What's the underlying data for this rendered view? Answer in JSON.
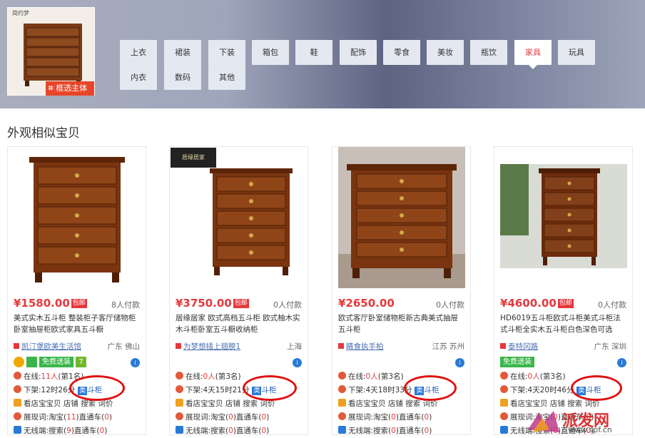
{
  "header": {
    "thumb_badge": "框选主体",
    "thumb_caption": "简约梦"
  },
  "categories": [
    {
      "label": "上衣"
    },
    {
      "label": "内衣"
    },
    {
      "label": "裙装"
    },
    {
      "label": "数码"
    },
    {
      "label": "下装"
    },
    {
      "label": "其他"
    },
    {
      "label": "箱包"
    },
    {
      "label": "鞋"
    },
    {
      "label": "配饰"
    },
    {
      "label": "零食"
    },
    {
      "label": "美妆"
    },
    {
      "label": "瓶饮"
    },
    {
      "label": "家具"
    },
    {
      "label": "玩具"
    }
  ],
  "section_title": "外观相似宝贝",
  "products": [
    {
      "price": "¥1580.00",
      "baoyou": "包邮",
      "paid": "8人付款",
      "title": "美式实木五斗柜 整装柜子客厅储物柜卧室抽屉柜欧式家具五斗橱",
      "shop": "凯汀堡欧美生活馆",
      "loc": "广东 佛山",
      "badge_free": "免费送装",
      "online": "在线:",
      "online_n": "11人",
      "online_rank": "(第1名)",
      "shelf": "下架:12时26分",
      "cat_icon": "类",
      "cat_name": "斗柜",
      "view": "看店宝宝贝 店铺 搜索 词价",
      "show": "展现词:淘宝(",
      "show_n": "11",
      "show_mid": ")直通车(",
      "show_n2": "0",
      "show_end": ")",
      "wireless": "无线端:搜索(",
      "wireless_n": "9",
      "wireless_mid": ")直通车(",
      "wireless_n2": "0",
      "wireless_end": ")"
    },
    {
      "price": "¥3750.00",
      "baoyou": "包邮",
      "paid": "0人付款",
      "title": "居缘居家 欧式高档五斗柜 欧式柚木实木斗柜卧室五斗橱收纳柜",
      "shop": "为梦想插上翅膀1",
      "loc": "上海",
      "img_tag": "居缘居家",
      "online": "在线:",
      "online_n": "0人",
      "online_rank": "(第3名)",
      "shelf": "下架:4天15时21分",
      "cat_icon": "类",
      "cat_name": "斗柜",
      "view": "看店宝宝贝 店铺 搜索 词价",
      "show": "展现词:淘宝(",
      "show_n": "0",
      "show_mid": ")直通车(",
      "show_n2": "0",
      "show_end": ")",
      "wireless": "无线端:搜索(",
      "wireless_n": "0",
      "wireless_mid": ")直通车(",
      "wireless_n2": "0",
      "wireless_end": ")"
    },
    {
      "price": "¥2650.00",
      "paid": "0人付款",
      "title": "欧式客厅卧室储物柜新古典美式抽屉五斗柜",
      "shop": "睛食执手柏",
      "loc": "江苏 苏州",
      "online": "在线:",
      "online_n": "0人",
      "online_rank": "(第3名)",
      "shelf": "下架:4天18时33分",
      "cat_icon": "类",
      "cat_name": "斗柜",
      "view": "看店宝宝贝 店铺 搜索 词价",
      "show": "展现词:淘宝(",
      "show_n": "0",
      "show_mid": ")直通车(",
      "show_n2": "0",
      "show_end": ")",
      "wireless": "无线端:搜索(",
      "wireless_n": "0",
      "wireless_mid": ")直通车(",
      "wireless_n2": "0",
      "wireless_end": ")"
    },
    {
      "price": "¥4600.00",
      "baoyou": "包邮",
      "paid": "0人付款",
      "title": "HD6019五斗柜欧式斗柜美式斗柜法式斗柜全实木五斗柜白色深色可选",
      "shop": "泰特冈路",
      "loc": "广东 深圳",
      "badge_free": "免费送装",
      "online": "在线:",
      "online_n": "0人",
      "online_rank": "(第3名)",
      "shelf": "下架:4天20时46分",
      "cat_icon": "类",
      "cat_name": "斗柜",
      "view": "看店宝宝贝 店铺 搜索 词价",
      "show": "展现词:淘宝(",
      "show_n": "0",
      "show_mid": ")直通车(",
      "show_n2": "0",
      "show_end": ")",
      "wireless": "无线端:搜索(",
      "wireless_n": "0",
      "wireless_mid": ")直通车(",
      "wireless_n2": "0",
      "wireless_end": ")"
    }
  ],
  "watermark": {
    "brand": "派发网",
    "url": "www.spf.cn"
  }
}
